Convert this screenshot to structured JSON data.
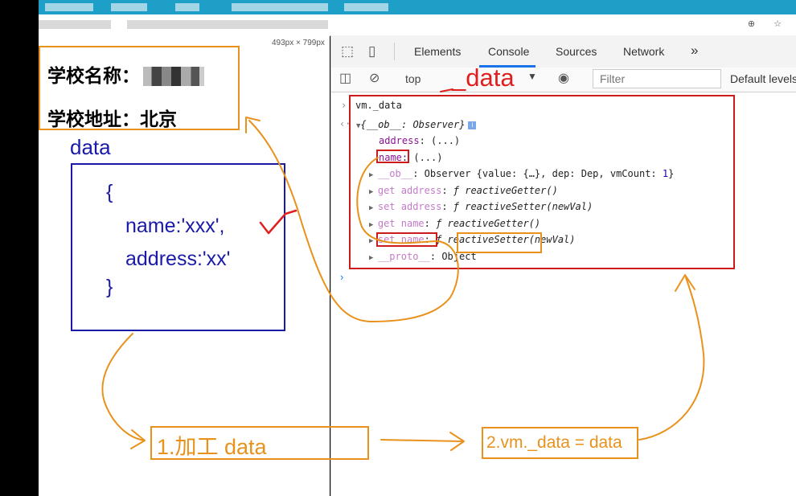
{
  "browser": {
    "dimension_label": "493px × 799px",
    "addr_icons": "⊕ ☆"
  },
  "page": {
    "school_name_label": "学校名称：",
    "school_addr_label": "学校地址：",
    "school_addr_value": "北京"
  },
  "annotation": {
    "data_label": "data",
    "code": {
      "open": "{",
      "name_line": "name:'xxx',",
      "addr_line": "address:'xx'",
      "close": "}"
    },
    "red_data_label": "_data",
    "step1": "1.加工 data",
    "step2": "2.vm._data = data",
    "colors": {
      "red": "#cc1b1b",
      "orange": "#e8921c",
      "blue": "#1a1aa8"
    }
  },
  "devtools": {
    "tabs": [
      "Elements",
      "Console",
      "Sources",
      "Network",
      "»"
    ],
    "active_tab": "Console",
    "context": "top",
    "filter_placeholder": "Filter",
    "levels_label": "Default levels ▾",
    "icons": [
      "inspect-icon",
      "device-icon",
      "sidebar-icon",
      "clear-icon",
      "eye-icon"
    ]
  },
  "console": {
    "input": "vm._data",
    "lines": [
      {
        "key": "address",
        "rest": ": (...)"
      },
      {
        "key": "name",
        "rest": ": (...)"
      }
    ],
    "root": "{__ob__: Observer}",
    "ob_line": {
      "key": "__ob__",
      "rest": ": Observer {value: {…}, dep: Dep, vmCount: ",
      "count": "1",
      "end": "}"
    },
    "get_address": {
      "key": "get address",
      "sep": ": ",
      "f": "ƒ ",
      "fn": "reactiveGetter()"
    },
    "set_address": {
      "key": "set address",
      "sep": ": ",
      "f": "ƒ ",
      "fn": "reactiveSetter(newVal)"
    },
    "get_name": {
      "key": "get name",
      "sep": ": ",
      "f": "ƒ ",
      "fn": "reactiveGetter()"
    },
    "set_name": {
      "key": "set name",
      "sep": ": ",
      "f": "ƒ ",
      "fn": "reactiveSetter(newVal)"
    },
    "proto": {
      "key": "__proto__",
      "rest": ": Object"
    }
  }
}
